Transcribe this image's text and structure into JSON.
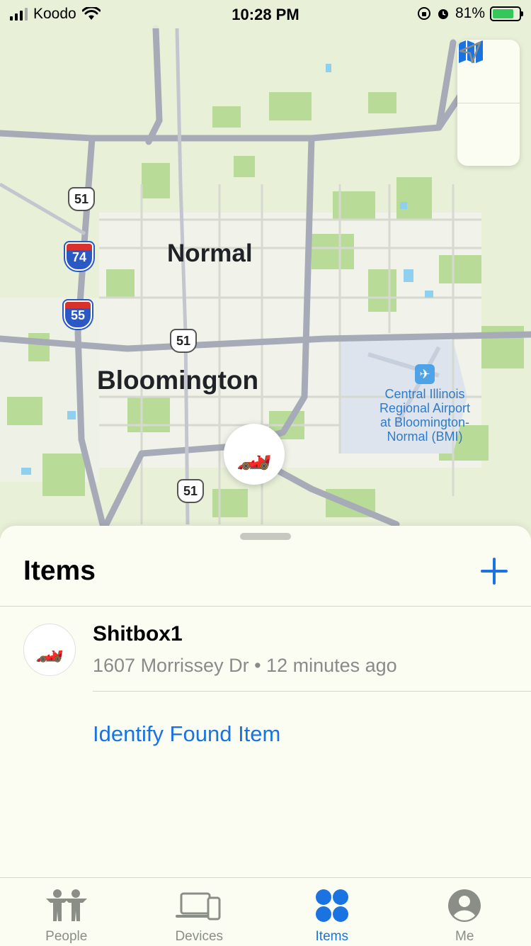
{
  "status_bar": {
    "carrier": "Koodo",
    "time": "10:28 PM",
    "battery": "81%",
    "battery_level": 0.81
  },
  "map": {
    "labels": {
      "city_1": "Normal",
      "city_2": "Bloomington",
      "airport_line1": "Central Illinois",
      "airport_line2": "Regional Airport",
      "airport_line3": "at Bloomington-",
      "airport_line4": "Normal (BMI)"
    },
    "route_shields": {
      "us51_a": "51",
      "us51_b": "51",
      "us51_c": "51",
      "i74": "74",
      "i55": "55"
    },
    "controls": [
      "map-icon",
      "location-arrow-icon"
    ],
    "pin_icon": "race-car"
  },
  "sheet": {
    "title": "Items",
    "add_icon": "plus-icon",
    "items": [
      {
        "name": "Shitbox1",
        "address": "1607 Morrissey Dr",
        "separator": "•",
        "time_ago": "12 minutes ago",
        "icon": "race-car"
      }
    ],
    "identify_link": "Identify Found Item"
  },
  "tabbar": {
    "tabs": [
      {
        "label": "People",
        "icon": "people-icon"
      },
      {
        "label": "Devices",
        "icon": "devices-icon"
      },
      {
        "label": "Items",
        "icon": "items-icon",
        "active": true
      },
      {
        "label": "Me",
        "icon": "person-circle-icon"
      }
    ]
  },
  "colors": {
    "accent": "#1a73e0",
    "map_land": "#e8f0d8",
    "map_park": "#b8dc98",
    "map_road": "#a7abb8"
  }
}
